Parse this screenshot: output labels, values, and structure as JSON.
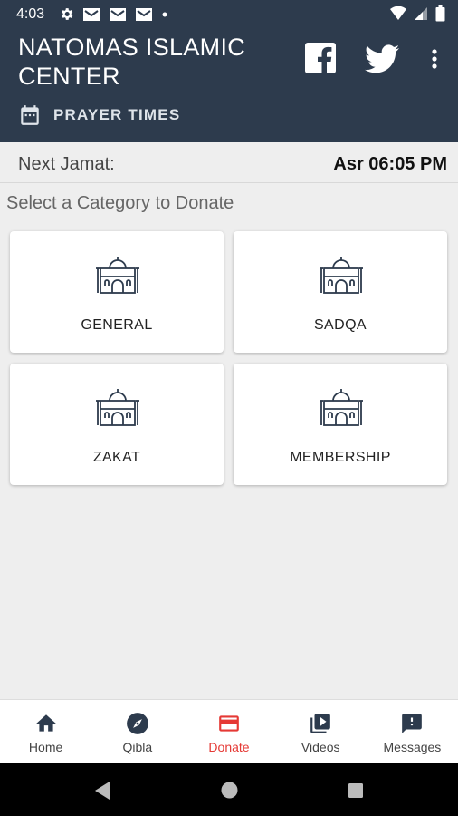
{
  "status_bar": {
    "time": "4:03"
  },
  "header": {
    "title": "NATOMAS ISLAMIC CENTER",
    "prayer_times_label": "PRAYER TIMES"
  },
  "jamat": {
    "label": "Next Jamat:",
    "value": "Asr 06:05 PM"
  },
  "section_title": "Select a Category to Donate",
  "categories": [
    {
      "label": "GENERAL"
    },
    {
      "label": "SADQA"
    },
    {
      "label": "ZAKAT"
    },
    {
      "label": "MEMBERSHIP"
    }
  ],
  "bottom_nav": [
    {
      "label": "Home",
      "icon": "home-icon"
    },
    {
      "label": "Qibla",
      "icon": "compass-icon"
    },
    {
      "label": "Donate",
      "icon": "credit-card-icon",
      "active": true
    },
    {
      "label": "Videos",
      "icon": "video-library-icon"
    },
    {
      "label": "Messages",
      "icon": "message-alert-icon"
    }
  ],
  "colors": {
    "header": "#2d3b4d",
    "active": "#e53935",
    "icon": "#2d3b4d",
    "background": "#eeeeee"
  }
}
